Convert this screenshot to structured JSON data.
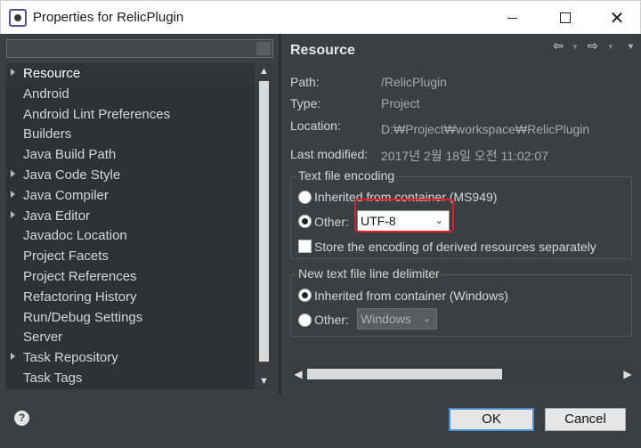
{
  "window": {
    "title": "Properties for RelicPlugin",
    "minimize_icon": "minimize-icon",
    "maximize_icon": "maximize-icon",
    "close_glyph": "✕"
  },
  "filter": {
    "value": "",
    "placeholder": ""
  },
  "tree": {
    "items": [
      {
        "label": "Resource",
        "expandable": true,
        "selected": true
      },
      {
        "label": "Android",
        "expandable": false
      },
      {
        "label": "Android Lint Preferences",
        "expandable": false
      },
      {
        "label": "Builders",
        "expandable": false
      },
      {
        "label": "Java Build Path",
        "expandable": false
      },
      {
        "label": "Java Code Style",
        "expandable": true
      },
      {
        "label": "Java Compiler",
        "expandable": true
      },
      {
        "label": "Java Editor",
        "expandable": true
      },
      {
        "label": "Javadoc Location",
        "expandable": false
      },
      {
        "label": "Project Facets",
        "expandable": false
      },
      {
        "label": "Project References",
        "expandable": false
      },
      {
        "label": "Refactoring History",
        "expandable": false
      },
      {
        "label": "Run/Debug Settings",
        "expandable": false
      },
      {
        "label": "Server",
        "expandable": false
      },
      {
        "label": "Task Repository",
        "expandable": true
      },
      {
        "label": "Task Tags",
        "expandable": false
      }
    ],
    "scroll_up": "▲",
    "scroll_down": "▼"
  },
  "page": {
    "title": "Resource",
    "nav": {
      "back": "⇦",
      "forward": "⇨",
      "dropdown": "▼",
      "menu": "▼"
    },
    "info": {
      "path_label": "Path:",
      "path_value": "/RelicPlugin",
      "type_label": "Type:",
      "type_value": "Project",
      "location_label": "Location:",
      "location_value": "D:₩Project₩workspace₩RelicPlugin",
      "modified_label": "Last modified:",
      "modified_value": "2017년 2월 18일 오전 11:02:07"
    },
    "encoding": {
      "title": "Text file encoding",
      "inherited_label": "Inherited from container (MS949)",
      "other_label": "Other:",
      "other_value": "UTF-8",
      "selected": "other",
      "derived_label": "Store the encoding of derived resources separately",
      "derived_checked": false
    },
    "delimiter": {
      "title": "New text file line delimiter",
      "inherited_label": "Inherited from container (Windows)",
      "other_label": "Other:",
      "other_value": "Windows",
      "selected": "inherited"
    },
    "hscroll": {
      "left": "◀",
      "right": "▶"
    }
  },
  "footer": {
    "help_label": "?",
    "ok_label": "OK",
    "cancel_label": "Cancel"
  },
  "colors": {
    "background": "#3c3f41",
    "annotation": "#e0202a",
    "focus": "#4a8fd4"
  }
}
